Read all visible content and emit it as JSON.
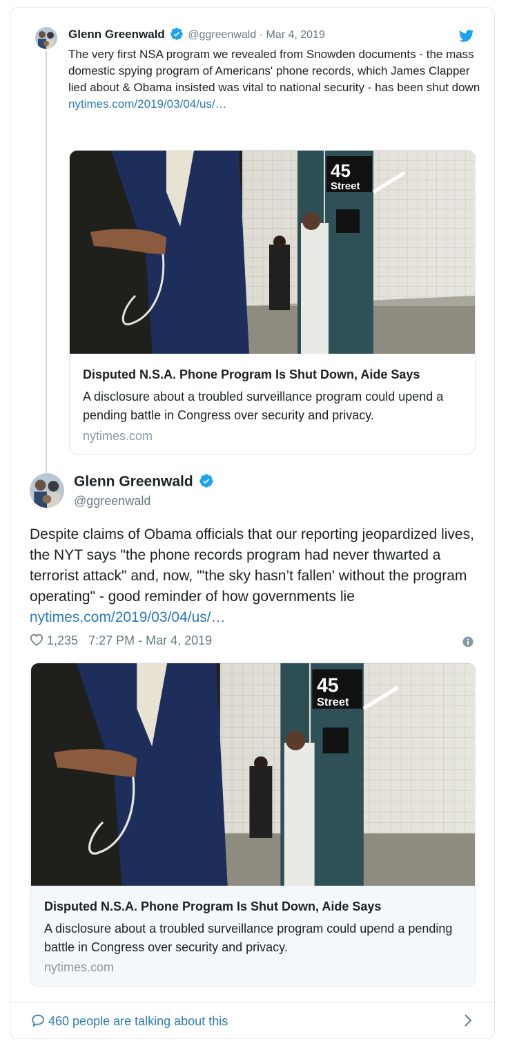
{
  "quoted": {
    "display_name": "Glenn Greenwald",
    "handle_date": "@ggreenwald · Mar 4, 2019",
    "text": "The very first NSA program we revealed from Snowden documents - the mass domestic spying program of Americans' phone records, which James Clapper lied about & Obama insisted was vital to national security - has been shut down",
    "link": "nytimes.com/2019/03/04/us/…",
    "card": {
      "title": "Disputed N.S.A. Phone Program Is Shut Down, Aide Says",
      "description": "A disclosure about a troubled surveillance program could upend a pending battle in Congress over security and privacy.",
      "domain": "nytimes.com",
      "sign_number": "45",
      "sign_word": "Street"
    }
  },
  "main": {
    "display_name": "Glenn Greenwald",
    "handle": "@ggreenwald",
    "text": "Despite claims of Obama officials that our reporting jeopardized lives, the NYT says \"the phone records program had never thwarted a terrorist attack\" and, now, \"'the sky hasn’t fallen' without the program operating\" - good reminder of how governments lie",
    "link": "nytimes.com/2019/03/04/us/…",
    "likes": "1,235",
    "timestamp": "7:27 PM - Mar 4, 2019",
    "card": {
      "title": "Disputed N.S.A. Phone Program Is Shut Down, Aide Says",
      "description": "A disclosure about a troubled surveillance program could upend a pending battle in Congress over security and privacy.",
      "domain": "nytimes.com",
      "sign_number": "45",
      "sign_word": "Street"
    }
  },
  "footer": {
    "talking": "460 people are talking about this"
  },
  "icons": {
    "verified": "verified-badge-icon",
    "bird": "twitter-bird-icon",
    "heart": "heart-icon",
    "info": "info-icon",
    "comment": "comment-bubble-icon",
    "chevron": "chevron-right-icon"
  },
  "colors": {
    "link": "#2b7bb9",
    "twitter_blue": "#1da1f2",
    "muted": "#697882",
    "border": "#e1e8ed"
  }
}
